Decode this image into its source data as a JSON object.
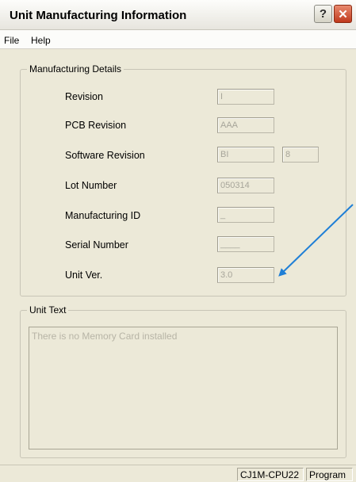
{
  "window": {
    "title": "Unit Manufacturing Information"
  },
  "titlebar": {
    "help_glyph": "?",
    "close_glyph": "✕"
  },
  "menu": {
    "items": [
      "File",
      "Help"
    ]
  },
  "details": {
    "caption": "Manufacturing Details",
    "rows": [
      {
        "label": "Revision",
        "value": "I"
      },
      {
        "label": "PCB Revision",
        "value": "AAA"
      },
      {
        "label": "Software Revision",
        "value": "BI",
        "value2": "8"
      },
      {
        "label": "Lot Number",
        "value": "050314"
      },
      {
        "label": "Manufacturing ID",
        "value": "_"
      },
      {
        "label": "Serial Number",
        "value": "____"
      },
      {
        "label": "Unit Ver.",
        "value": "3.0"
      }
    ]
  },
  "unit_text": {
    "caption": "Unit Text",
    "content": "There is no Memory Card installed"
  },
  "status": {
    "model": "CJ1M-CPU22",
    "mode": "Program"
  },
  "colors": {
    "annotation_arrow": "#1f7fd6",
    "close_button": "#c0381c"
  }
}
